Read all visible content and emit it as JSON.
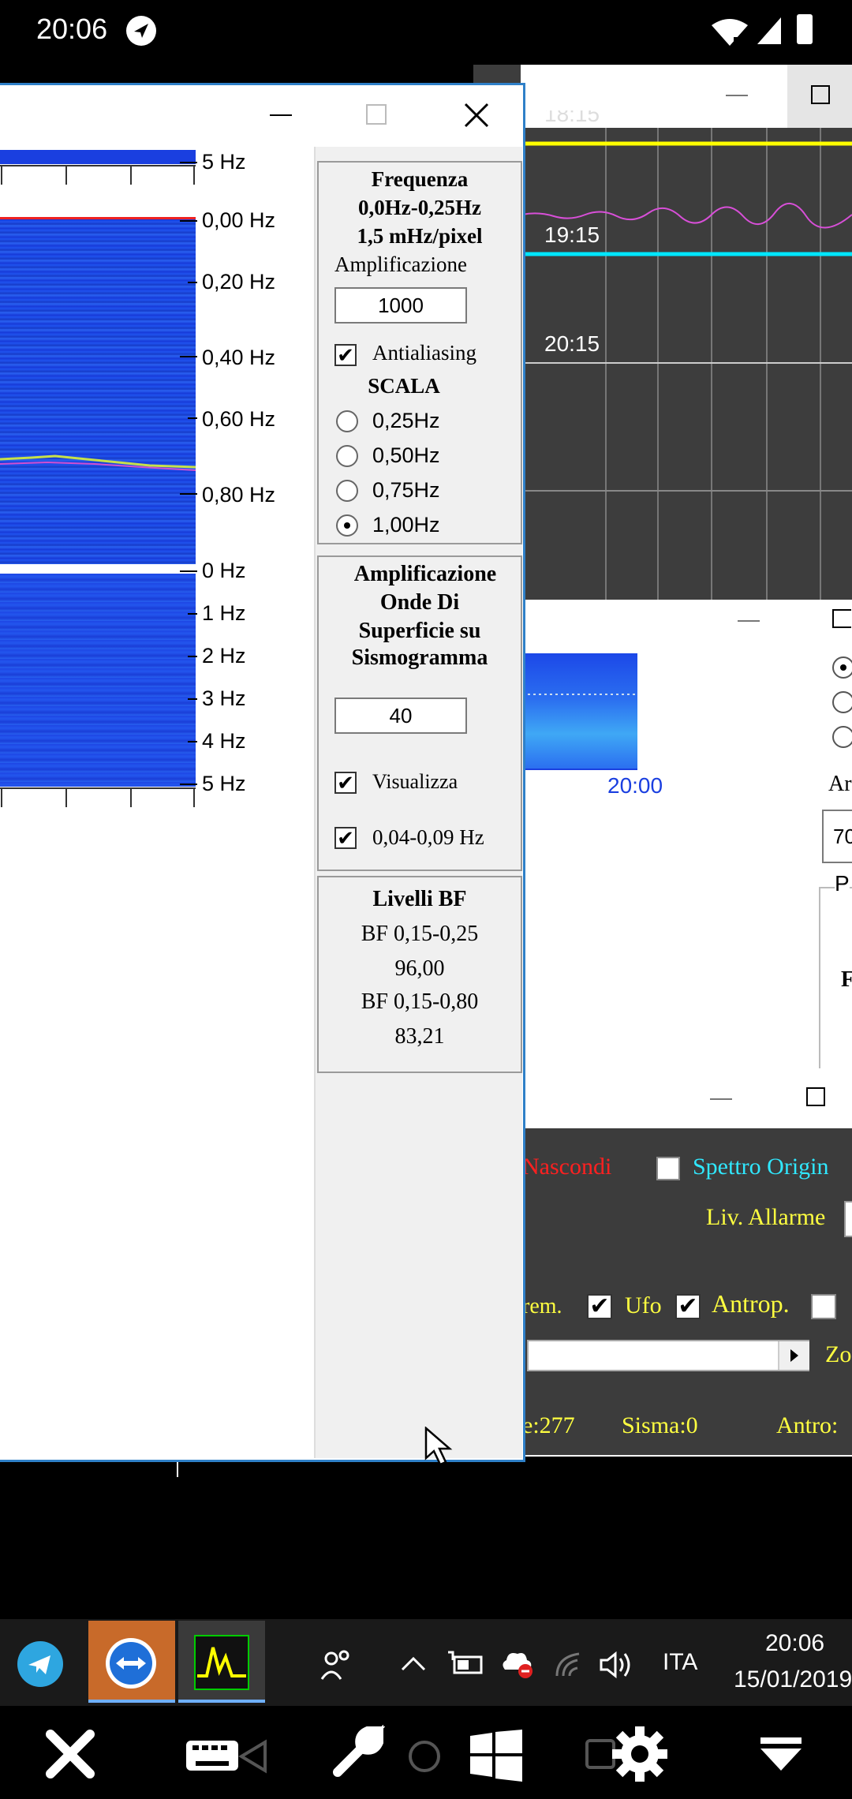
{
  "status_bar": {
    "time": "20:06"
  },
  "front_window": {
    "freq_panel": {
      "title": "Frequenza",
      "range": "0,0Hz-0,25Hz",
      "resolution": "1,5 mHz/pixel",
      "amp_label": "Amplificazione",
      "amp_value": "1000",
      "antialiasing_label": "Antialiasing",
      "scale_title": "SCALA",
      "scale_options": [
        "0,25Hz",
        "0,50Hz",
        "0,75Hz",
        "1,00Hz"
      ]
    },
    "surface_panel": {
      "title_lines": [
        "Amplificazione",
        "Onde Di",
        "Superficie su",
        "Sismogramma"
      ],
      "amp_value": "40",
      "visualizza_label": "Visualizza",
      "band_label": "0,04-0,09 Hz"
    },
    "bf_panel": {
      "title": "Livelli BF",
      "bf1_label": "BF 0,15-0,25",
      "bf1_value": "96,00",
      "bf2_label": "BF 0,15-0,80",
      "bf2_value": "83,21"
    },
    "top_axis": {
      "labels": [
        "5 Hz",
        "0,00 Hz",
        "0,20 Hz",
        "0,40 Hz",
        "0,60 Hz",
        "0,80 Hz"
      ]
    },
    "bottom_axis": {
      "labels": [
        "0 Hz",
        "1 Hz",
        "2 Hz",
        "3 Hz",
        "4 Hz",
        "5 Hz"
      ]
    }
  },
  "seismo_window": {
    "times": [
      "19:15",
      "20:15"
    ],
    "partial_time": "18:15"
  },
  "spectro_window": {
    "time_label": "20:00",
    "input_partial": "70",
    "left_partial": "Ar",
    "p_partial": "P",
    "f_partial": "F"
  },
  "control_window": {
    "hide_label": "Nascondi",
    "orig_spectrum_label": "Spettro Origin",
    "alarm_label": "Liv. Allarme",
    "trem_label": "rem.",
    "ufo_label": "Ufo",
    "antrop_label": "Antrop.",
    "zoom_partial": "Zo",
    "count_partial": "e:277",
    "sisma_label": "Sisma:0",
    "antro_label": "Antro:"
  },
  "taskbar": {
    "lang": "ITA",
    "time": "20:06",
    "date": "15/01/2019"
  },
  "colors": {
    "spectrogram": "#1a3fe0",
    "window_border": "#2f80c8",
    "seismo_bg": "#3d3d3d"
  }
}
